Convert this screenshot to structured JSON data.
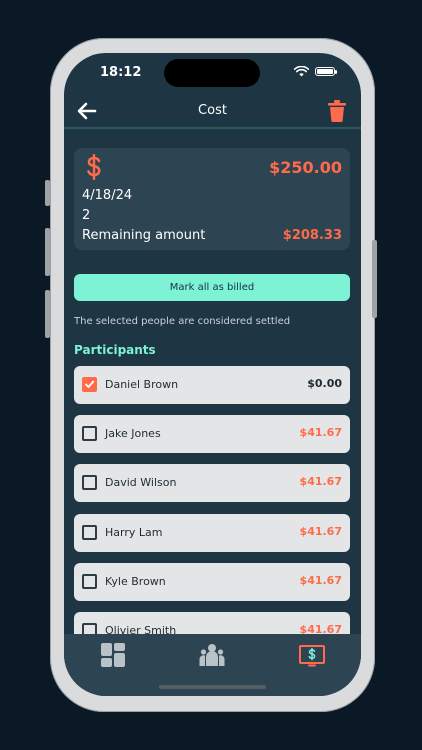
{
  "status_bar": {
    "time": "18:12"
  },
  "header": {
    "title": "Cost"
  },
  "summary": {
    "total": "$250.00",
    "date": "4/18/24",
    "count": "2",
    "remaining_label": "Remaining amount",
    "remaining_value": "$208.33"
  },
  "actions": {
    "mark_all_label": "Mark all as billed",
    "settled_note": "The selected people are considered settled"
  },
  "participants": {
    "heading": "Participants",
    "items": [
      {
        "name": "Daniel Brown",
        "amount": "$0.00",
        "checked": true
      },
      {
        "name": "Jake Jones",
        "amount": "$41.67",
        "checked": false
      },
      {
        "name": "David Wilson",
        "amount": "$41.67",
        "checked": false
      },
      {
        "name": "Harry Lam",
        "amount": "$41.67",
        "checked": false
      },
      {
        "name": "Kyle Brown",
        "amount": "$41.67",
        "checked": false
      },
      {
        "name": "Olivier Smith",
        "amount": "$41.67",
        "checked": false
      }
    ]
  },
  "tabs": [
    {
      "icon": "dashboard-icon",
      "active": false
    },
    {
      "icon": "group-icon",
      "active": false
    },
    {
      "icon": "cost-icon",
      "active": true
    }
  ],
  "colors": {
    "accent": "#7ef2d4",
    "alert": "#ff6b4a",
    "screen_bg": "#1e3544",
    "card_bg": "#2d4453"
  }
}
